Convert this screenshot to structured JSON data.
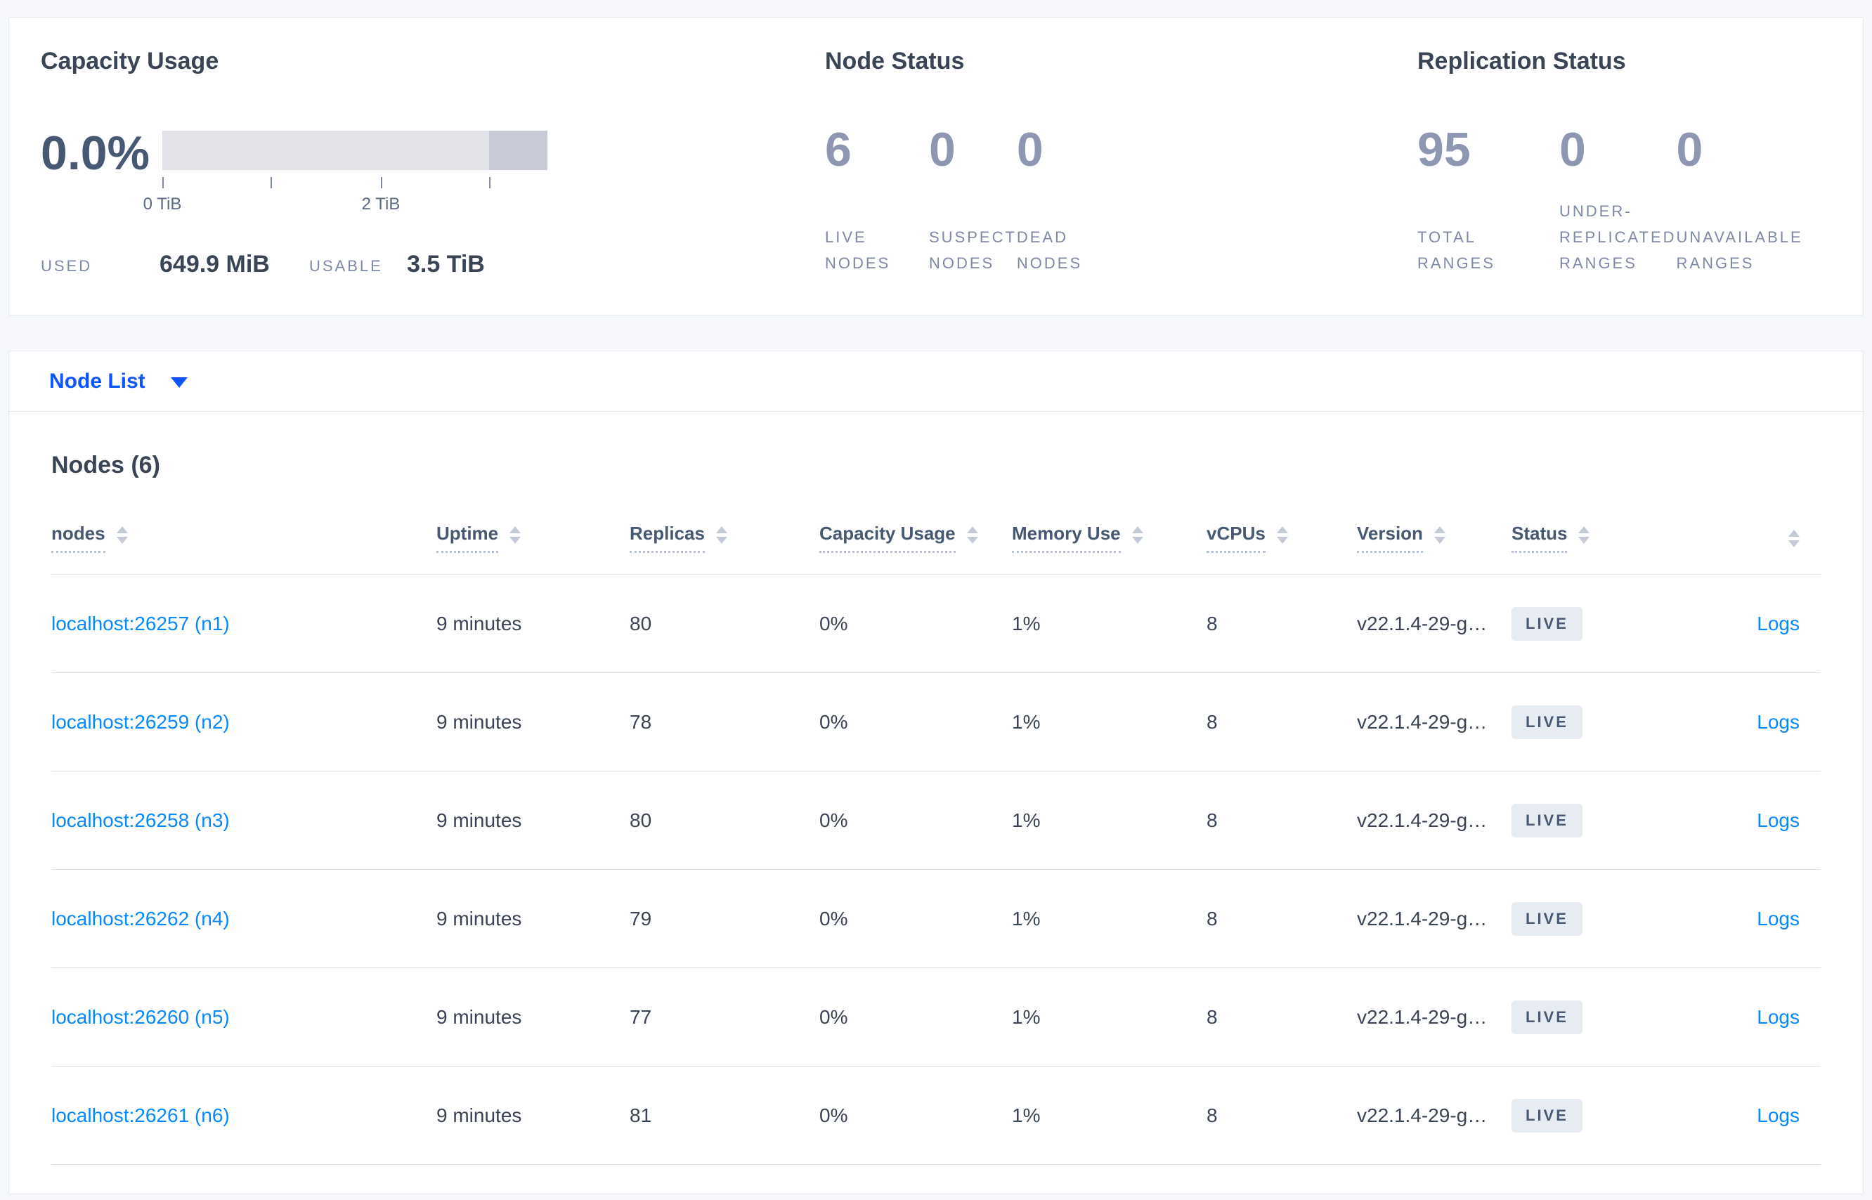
{
  "panels": {
    "capacity": {
      "title": "Capacity Usage",
      "percent": "0.0%",
      "axis": {
        "tick0": "0 TiB",
        "tick2": "2 TiB"
      },
      "used_label": "USED",
      "used_value": "649.9 MiB",
      "usable_label": "USABLE",
      "usable_value": "3.5 TiB"
    },
    "node_status": {
      "title": "Node Status",
      "stats": [
        {
          "value": "6",
          "label": "LIVE\nNODES"
        },
        {
          "value": "0",
          "label": "SUSPECT\nNODES"
        },
        {
          "value": "0",
          "label": "DEAD\nNODES"
        }
      ]
    },
    "replication": {
      "title": "Replication Status",
      "stats": [
        {
          "value": "95",
          "label": "TOTAL\nRANGES"
        },
        {
          "value": "0",
          "label": "UNDER-\nREPLICATED\nRANGES"
        },
        {
          "value": "0",
          "label": "UNAVAILABLE\nRANGES"
        }
      ]
    }
  },
  "node_list": {
    "dropdown_label": "Node List"
  },
  "table": {
    "title": "Nodes (6)",
    "columns": [
      {
        "label": "nodes"
      },
      {
        "label": "Uptime"
      },
      {
        "label": "Replicas"
      },
      {
        "label": "Capacity Usage"
      },
      {
        "label": "Memory Use"
      },
      {
        "label": "vCPUs"
      },
      {
        "label": "Version"
      },
      {
        "label": "Status"
      },
      {
        "label": ""
      }
    ],
    "rows": [
      {
        "node": "localhost:26257 (n1)",
        "uptime": "9 minutes",
        "replicas": "80",
        "capacity": "0%",
        "memory": "1%",
        "vcpus": "8",
        "version": "v22.1.4-29-g…",
        "status": "LIVE",
        "logs": "Logs"
      },
      {
        "node": "localhost:26259 (n2)",
        "uptime": "9 minutes",
        "replicas": "78",
        "capacity": "0%",
        "memory": "1%",
        "vcpus": "8",
        "version": "v22.1.4-29-g…",
        "status": "LIVE",
        "logs": "Logs"
      },
      {
        "node": "localhost:26258 (n3)",
        "uptime": "9 minutes",
        "replicas": "80",
        "capacity": "0%",
        "memory": "1%",
        "vcpus": "8",
        "version": "v22.1.4-29-g…",
        "status": "LIVE",
        "logs": "Logs"
      },
      {
        "node": "localhost:26262 (n4)",
        "uptime": "9 minutes",
        "replicas": "79",
        "capacity": "0%",
        "memory": "1%",
        "vcpus": "8",
        "version": "v22.1.4-29-g…",
        "status": "LIVE",
        "logs": "Logs"
      },
      {
        "node": "localhost:26260 (n5)",
        "uptime": "9 minutes",
        "replicas": "77",
        "capacity": "0%",
        "memory": "1%",
        "vcpus": "8",
        "version": "v22.1.4-29-g…",
        "status": "LIVE",
        "logs": "Logs"
      },
      {
        "node": "localhost:26261 (n6)",
        "uptime": "9 minutes",
        "replicas": "81",
        "capacity": "0%",
        "memory": "1%",
        "vcpus": "8",
        "version": "v22.1.4-29-g…",
        "status": "LIVE",
        "logs": "Logs"
      }
    ]
  },
  "colors": {
    "accent_blue": "#0788ff",
    "dropdown_blue": "#0a55ff",
    "heading": "#394455",
    "stat_dark": "#475872",
    "stat_muted": "#8d97b2",
    "label_muted": "#7e89a6",
    "bar_light": "#e1e3e9",
    "bar_dark": "#c8ccd6",
    "badge_bg": "#e7ecf3",
    "page_bg": "#f5f7fa"
  }
}
